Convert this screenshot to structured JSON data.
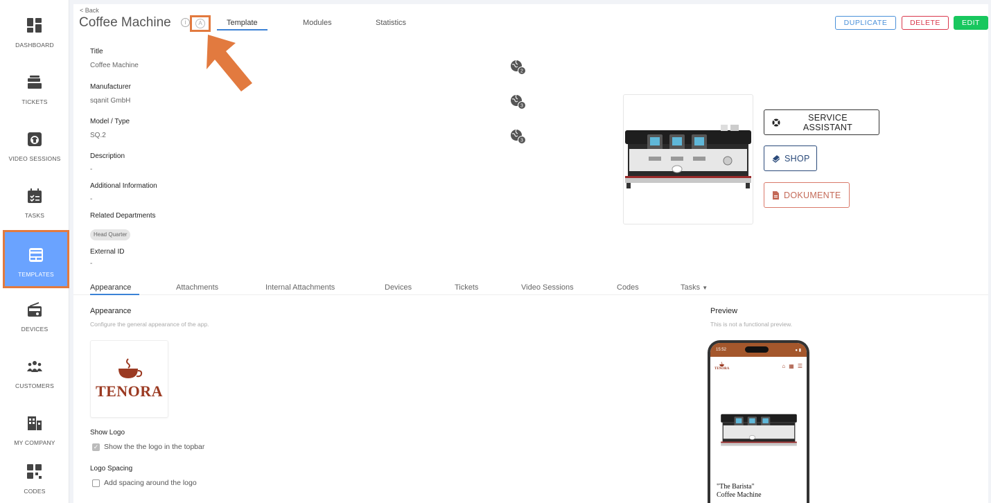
{
  "sidebar": {
    "items": [
      {
        "label": "DASHBOARD",
        "icon": "dashboard-icon"
      },
      {
        "label": "TICKETS",
        "icon": "tickets-icon"
      },
      {
        "label": "VIDEO SESSIONS",
        "icon": "video-sessions-icon"
      },
      {
        "label": "TASKS",
        "icon": "tasks-icon"
      },
      {
        "label": "TEMPLATES",
        "icon": "templates-icon",
        "active": true
      },
      {
        "label": "DEVICES",
        "icon": "devices-icon"
      },
      {
        "label": "CUSTOMERS",
        "icon": "customers-icon"
      },
      {
        "label": "MY COMPANY",
        "icon": "my-company-icon"
      },
      {
        "label": "CODES",
        "icon": "codes-icon"
      }
    ]
  },
  "header": {
    "back": "< Back",
    "title": "Coffee Machine",
    "tabs": [
      "Template",
      "Modules",
      "Statistics"
    ],
    "buttons": {
      "duplicate": "DUPLICATE",
      "delete": "DELETE",
      "edit": "EDIT"
    }
  },
  "details": {
    "fields": [
      {
        "label": "Title",
        "value": "Coffee Machine",
        "translations": "2"
      },
      {
        "label": "Manufacturer",
        "value": "sqanit GmbH",
        "translations": "3"
      },
      {
        "label": "Model / Type",
        "value": "SQ.2",
        "translations": "3"
      },
      {
        "label": "Description",
        "value": "-"
      },
      {
        "label": "Additional Information",
        "value": "-"
      },
      {
        "label": "Related Departments",
        "chip": "Head Quarter"
      },
      {
        "label": "External ID",
        "value": "-"
      }
    ],
    "actions": {
      "service_assistant": "SERVICE ASSISTANT",
      "shop": "SHOP",
      "dokumente": "DOKUMENTE"
    }
  },
  "subtabs": [
    "Appearance",
    "Attachments",
    "Internal Attachments",
    "Devices",
    "Tickets",
    "Video Sessions",
    "Codes",
    "Tasks"
  ],
  "appearance": {
    "title": "Appearance",
    "description": "Configure the general appearance of the app.",
    "logo_text": "TENORA",
    "show_logo": {
      "label": "Show Logo",
      "checkbox": "Show the the logo in the topbar",
      "checked": true
    },
    "logo_spacing": {
      "label": "Logo Spacing",
      "checkbox": "Add spacing around the logo",
      "checked": false
    }
  },
  "preview": {
    "title": "Preview",
    "description": "This is not a functional preview.",
    "time": "15:52",
    "logo_text": "TENORA",
    "title_line1": "\"The Barista\"",
    "title_line2": "Coffee Machine"
  },
  "colors": {
    "accent": "#3b82d6",
    "highlight": "#e27a3f",
    "active_nav": "#6aa3ff",
    "brand": "#9b3a22",
    "phone_bar": "#a4572c"
  }
}
